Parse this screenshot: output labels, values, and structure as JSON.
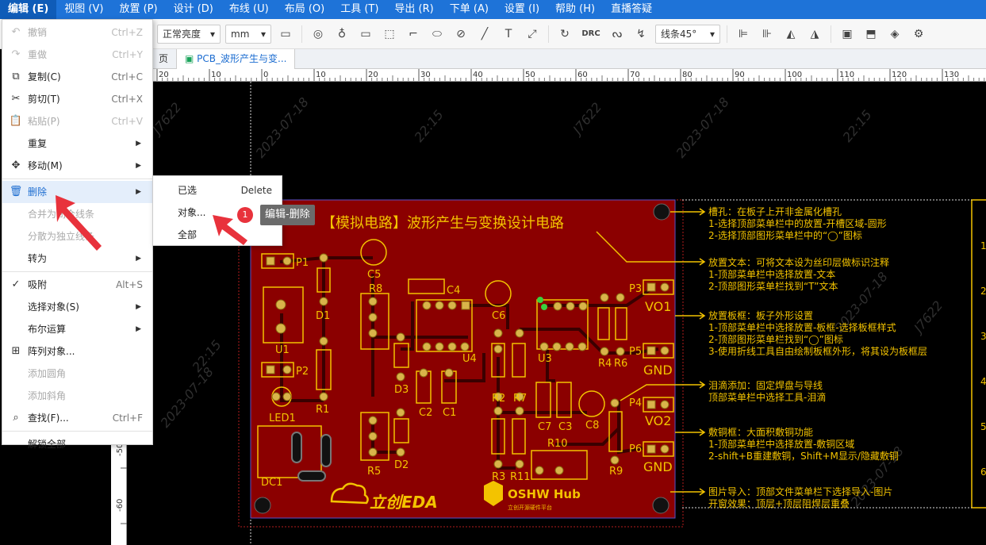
{
  "menubar": [
    {
      "label": "编辑 (E)",
      "active": true
    },
    {
      "label": "视图 (V)"
    },
    {
      "label": "放置 (P)"
    },
    {
      "label": "设计 (D)"
    },
    {
      "label": "布线 (U)"
    },
    {
      "label": "布局 (O)"
    },
    {
      "label": "工具 (T)"
    },
    {
      "label": "导出 (R)"
    },
    {
      "label": "下单 (A)"
    },
    {
      "label": "设置 (I)"
    },
    {
      "label": "帮助 (H)"
    },
    {
      "label": "直播答疑"
    }
  ],
  "toolbar": {
    "brightness": "正常亮度",
    "unit": "mm",
    "drc": "DRC",
    "routing_mode": "线条45°"
  },
  "tabs": [
    {
      "label": "页"
    },
    {
      "label": "PCB_波形产生与变..."
    }
  ],
  "ruler_top": [
    "20",
    "10",
    "0",
    "10",
    "20",
    "30",
    "40",
    "50",
    "60",
    "70",
    "80",
    "90",
    "100",
    "110",
    "120",
    "130"
  ],
  "ruler_left": [
    "-50",
    "-60"
  ],
  "edit_menu": [
    {
      "label": "撤销",
      "shortcut": "Ctrl+Z",
      "icon": "undo-icon",
      "disabled": true
    },
    {
      "label": "重做",
      "shortcut": "Ctrl+Y",
      "icon": "redo-icon",
      "disabled": true
    },
    {
      "label": "复制(C)",
      "shortcut": "Ctrl+C",
      "icon": "copy-icon"
    },
    {
      "label": "剪切(T)",
      "shortcut": "Ctrl+X",
      "icon": "cut-icon"
    },
    {
      "label": "粘贴(P)",
      "shortcut": "Ctrl+V",
      "icon": "paste-icon",
      "disabled": true
    },
    {
      "label": "重复",
      "submenu": true
    },
    {
      "label": "移动(M)",
      "submenu": true,
      "icon": "move-icon"
    },
    {
      "label": "删除",
      "submenu": true,
      "icon": "trash-icon",
      "highlighted": true
    },
    {
      "label": "合并为闭合线条",
      "disabled": true
    },
    {
      "label": "分散为独立线条",
      "disabled": true
    },
    {
      "label": "转为",
      "submenu": true
    },
    {
      "label": "吸附",
      "shortcut": "Alt+S",
      "icon": "check-icon"
    },
    {
      "label": "选择对象(S)",
      "submenu": true
    },
    {
      "label": "布尔运算",
      "submenu": true
    },
    {
      "label": "阵列对象...",
      "icon": "grid-icon"
    },
    {
      "label": "添加圆角",
      "disabled": true
    },
    {
      "label": "添加斜角",
      "disabled": true
    },
    {
      "label": "查找(F)...",
      "shortcut": "Ctrl+F",
      "icon": "find-icon"
    },
    {
      "label": "解锁全部"
    }
  ],
  "delete_submenu": [
    {
      "label": "已选",
      "shortcut": "Delete"
    },
    {
      "label": "对象..."
    },
    {
      "label": "全部"
    }
  ],
  "annotation": {
    "badge": "1",
    "text": "编辑-删除"
  },
  "pcb": {
    "title": "【模拟电路】波形产生与变换设计电路",
    "labels": [
      "P1",
      "C5",
      "R8",
      "C4",
      "P3",
      "VO1",
      "C6",
      "D1",
      "U1",
      "P2",
      "U4",
      "U3",
      "R4",
      "R6",
      "P5",
      "GND",
      "D3",
      "C2",
      "C1",
      "R2",
      "R7",
      "LED1",
      "R1",
      "C7",
      "C3",
      "C8",
      "P4",
      "VO2",
      "D2",
      "R10",
      "R5",
      "R9",
      "P6",
      "GND",
      "DC1",
      "R3",
      "R11"
    ],
    "logo_lceda": "立创EDA",
    "logo_oshw": "OSHW Hub",
    "logo_oshw_sub": "立创开源硬件平台",
    "watermarks": [
      "2023-07-18",
      "22:15",
      "J7622"
    ],
    "notes": [
      [
        "槽孔：在板子上开非金属化槽孔",
        "1-选择顶部菜单栏中的放置-开槽区域-圆形",
        "2-选择顶部图形菜单栏中的“◯”图标"
      ],
      [
        "放置文本：可将文本设为丝印层做标识注释",
        "1-顶部菜单栏中选择放置-文本",
        "2-顶部图形菜单栏找到“T”文本"
      ],
      [
        "放置板框：板子外形设置",
        "1-顶部菜单栏中选择放置-板框-选择板框样式",
        "2-顶部图形菜单栏找到“◯”图标",
        "3-使用折线工具自由绘制板框外形，将其设为板框层"
      ],
      [
        "泪滴添加：固定焊盘与导线",
        "顶部菜单栏中选择工具-泪滴"
      ],
      [
        "敷铜框：大面积敷铜功能",
        "1-顶部菜单栏中选择放置-敷铜区域",
        "2-shift+B重建敷铜，Shift+M显示/隐藏敷铜"
      ],
      [
        "图片导入：顶部文件菜单栏下选择导入-图片",
        "开窗效果：顶层+顶层阻焊层重叠"
      ]
    ],
    "right_digits": [
      "1",
      "2",
      "3",
      "4",
      "5",
      "6"
    ]
  },
  "colors": {
    "menubar": "#1e73d8",
    "board": "#8b0000",
    "silk": "#f3c300",
    "highlight": "#1b6cd0",
    "badge": "#e8323c"
  }
}
